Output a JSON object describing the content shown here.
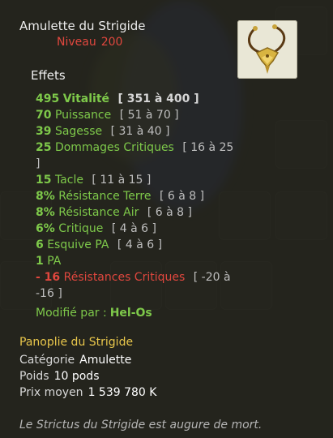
{
  "item": {
    "name": "Amulette du Strigide",
    "level_label": "Niveau",
    "level_value": "200",
    "icon": "amulet-icon"
  },
  "effects": {
    "title": "Effets",
    "lines": [
      {
        "value": "495",
        "name": "Vitalité",
        "range": "[ 351 à 400 ]",
        "style": "bold"
      },
      {
        "value": "70",
        "name": "Puissance",
        "range": "[ 51 à 70 ]",
        "style": "normal"
      },
      {
        "value": "39",
        "name": "Sagesse",
        "range": "[ 31 à 40 ]",
        "style": "normal"
      },
      {
        "value": "25",
        "name": "Dommages Critiques",
        "range": "[ 16 à 25",
        "style": "wrap",
        "continuation": "]"
      },
      {
        "value": "15",
        "name": "Tacle",
        "range": "[ 11 à 15 ]",
        "style": "normal"
      },
      {
        "value": "8%",
        "name": "Résistance Terre",
        "range": "[ 6 à 8 ]",
        "style": "normal"
      },
      {
        "value": "8%",
        "name": "Résistance Air",
        "range": "[ 6 à 8 ]",
        "style": "normal"
      },
      {
        "value": "6%",
        "name": "Critique",
        "range": "[ 4 à 6 ]",
        "style": "normal"
      },
      {
        "value": "6",
        "name": "Esquive PA",
        "range": "[ 4 à 6 ]",
        "style": "normal"
      },
      {
        "value": "1",
        "name": "PA",
        "range": "",
        "style": "normal"
      },
      {
        "value": "- 16",
        "name": "Résistances Critiques",
        "range": "[ -20 à",
        "style": "neg-wrap",
        "continuation": "-16 ]"
      }
    ],
    "modified_label": "Modifié par :",
    "modified_by": "Hel-Os"
  },
  "set": {
    "name": "Panoplie du Strigide"
  },
  "details": {
    "category_label": "Catégorie",
    "category_value": "Amulette",
    "weight_label": "Poids",
    "weight_value": "10 pods",
    "price_label": "Prix moyen",
    "price_value": "1 539 780 K"
  },
  "description": "Le Strictus du Strigide est augure de mort.",
  "colors": {
    "bonus": "#7ec94a",
    "malus": "#e0473e",
    "set": "#e8c64b",
    "level": "#e0473e"
  }
}
